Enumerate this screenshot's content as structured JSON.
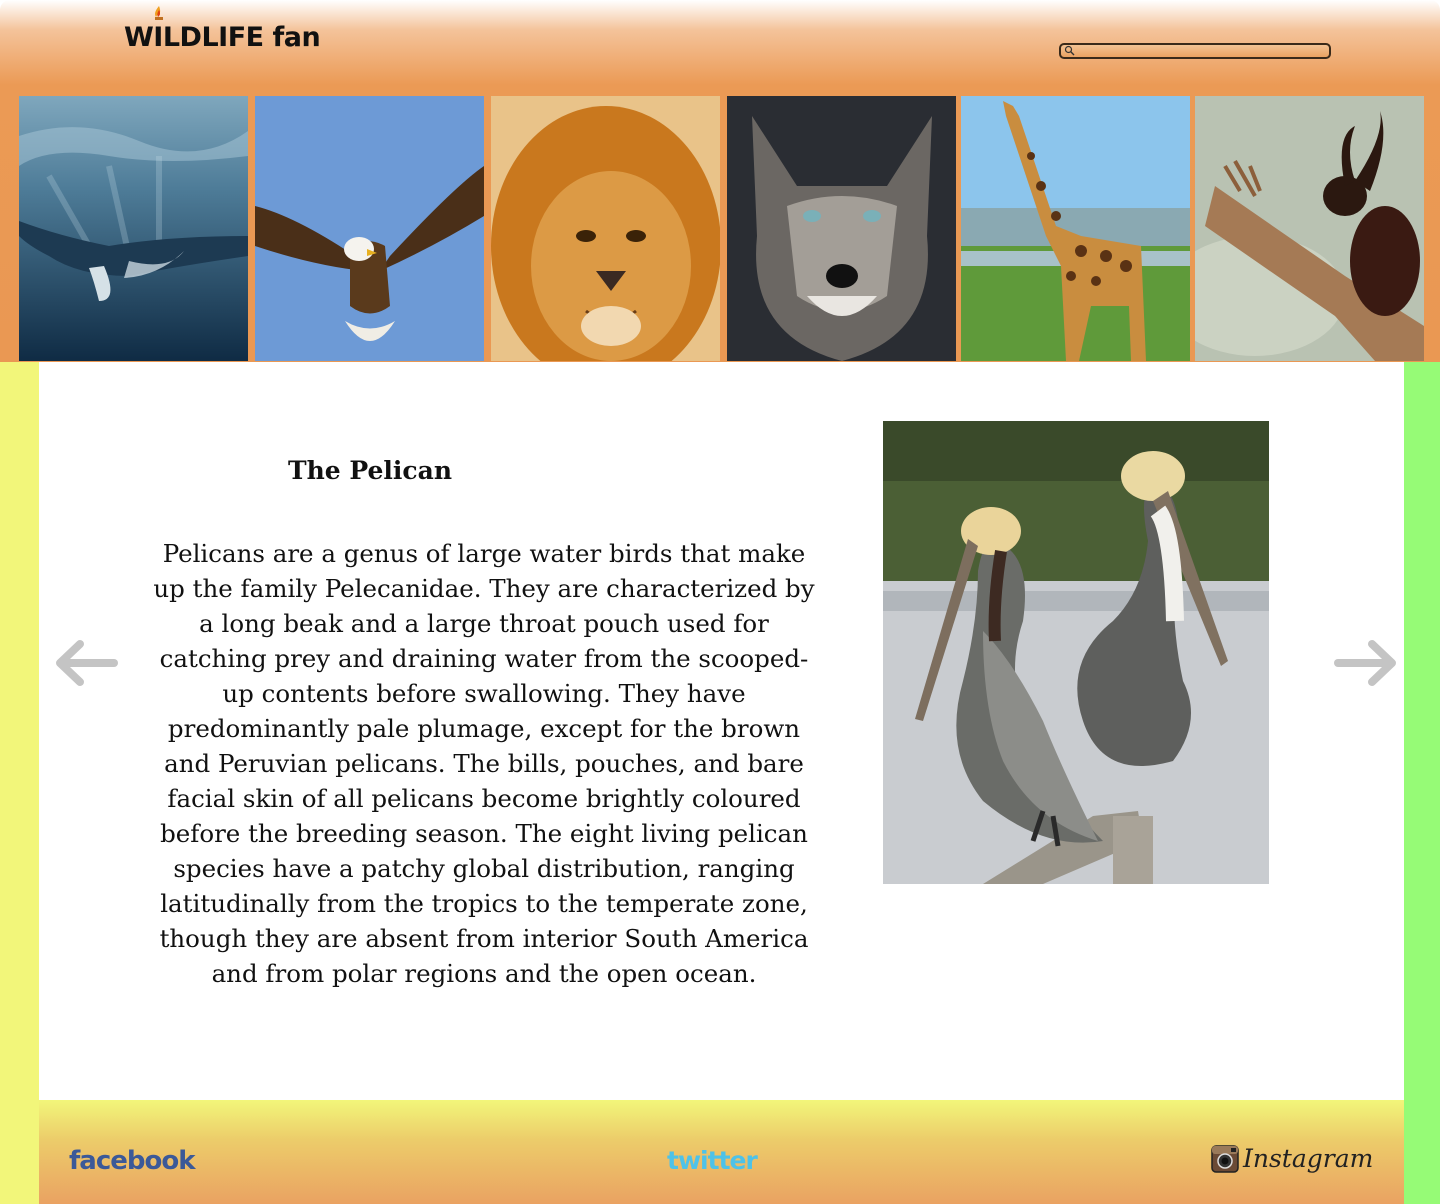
{
  "site": {
    "logo_text": "WILDLIFE fan"
  },
  "search": {
    "placeholder": ""
  },
  "gallery": [
    {
      "animal": "Whale"
    },
    {
      "animal": "Eagle"
    },
    {
      "animal": "Lion"
    },
    {
      "animal": "Wolf"
    },
    {
      "animal": "Giraffe"
    },
    {
      "animal": "Beetle"
    }
  ],
  "article": {
    "title": "The Pelican",
    "body": "Pelicans are a genus of large water birds that make up the family Pelecanidae. They are characterized by a long beak and a large throat pouch used for catching prey and draining water from the scooped-up contents before swallowing. They have predominantly pale plumage, except for the brown and Peruvian pelicans. The bills, pouches, and bare facial skin of all pelicans become brightly coloured before the breeding season. The eight living pelican species have a patchy global distribution, ranging latitudinally from the tropics to the temperate zone, though they are absent from interior South America and from polar regions and the open ocean."
  },
  "nav": {
    "prev_icon": "arrow-left-icon",
    "next_icon": "arrow-right-icon"
  },
  "footer": {
    "facebook": "facebook",
    "twitter": "twitter",
    "instagram": "Instagram"
  },
  "colors": {
    "header_orange": "#ea9853",
    "left_column": "#f2f67a",
    "right_column": "#96fb76",
    "arrow_gray": "#c4c4c4",
    "facebook_blue": "#3b5998",
    "twitter_blue": "#4ec2e8"
  }
}
